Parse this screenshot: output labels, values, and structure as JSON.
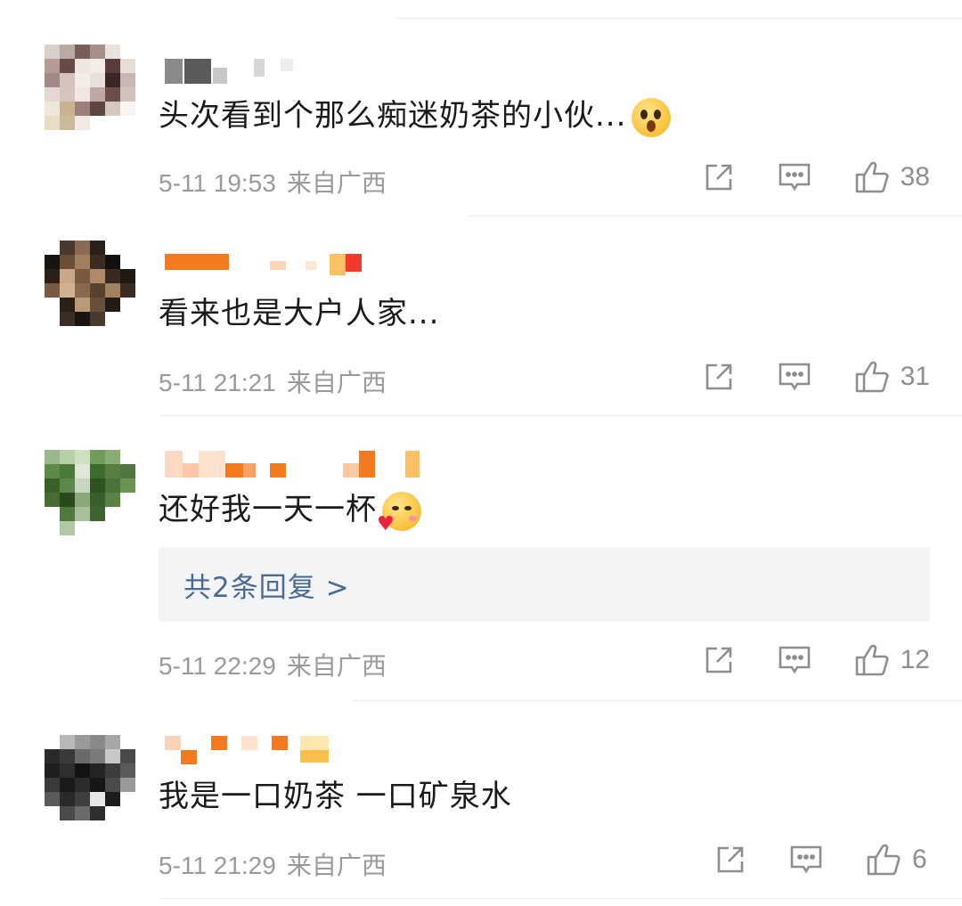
{
  "comments": [
    {
      "text": "头次看到个那么痴迷奶茶的小伙...",
      "emoji": "shocked-face-emoji",
      "date": "5-11 19:53",
      "location": "来自广西",
      "likes": "38"
    },
    {
      "text": "看来也是大户人家...",
      "emoji": "",
      "date": "5-11 21:21",
      "location": "来自广西",
      "likes": "31"
    },
    {
      "text": "还好我一天一杯",
      "emoji": "love-face-emoji",
      "replies_label": "共2条回复 >",
      "date": "5-11 22:29",
      "location": "来自广西",
      "likes": "12"
    },
    {
      "text": "我是一口奶茶 一口矿泉水",
      "emoji": "",
      "date": "5-11 21:29",
      "location": "来自广西",
      "likes": "6"
    }
  ],
  "icons": {
    "share": "share-icon",
    "reply": "comment-icon",
    "like": "thumbs-up-icon"
  },
  "colors": {
    "text": "#1a1a1a",
    "meta": "#9a9a9a",
    "reply_link": "#4a6a94",
    "reply_bg": "#f3f4f6",
    "name_orange": "#f47a1f"
  }
}
